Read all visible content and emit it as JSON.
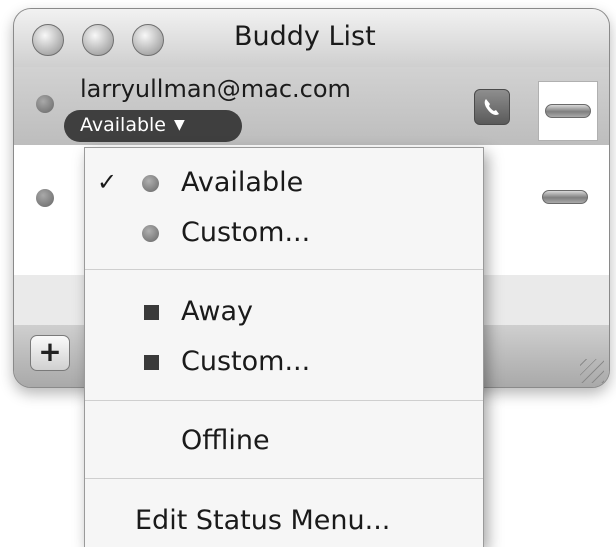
{
  "window": {
    "title": "Buddy List"
  },
  "account": {
    "email": "larryullman@mac.com",
    "status": "Available",
    "status_arrow": "▼",
    "phone_icon": "phone-icon",
    "buddy_icon": "fish-icon"
  },
  "bottom_bar": {
    "add_label": "+"
  },
  "status_menu": {
    "items": [
      {
        "label": "Available",
        "checked": true,
        "marker": "circle",
        "check": "✓"
      },
      {
        "label": "Custom...",
        "marker": "circle"
      },
      {
        "label": "Away",
        "marker": "square"
      },
      {
        "label": "Custom...",
        "marker": "square"
      },
      {
        "label": "Offline"
      },
      {
        "label": "Edit Status Menu..."
      }
    ]
  },
  "colors": {
    "status_pill": "#3f3f3f",
    "menu_background": "#f6f6f6"
  }
}
